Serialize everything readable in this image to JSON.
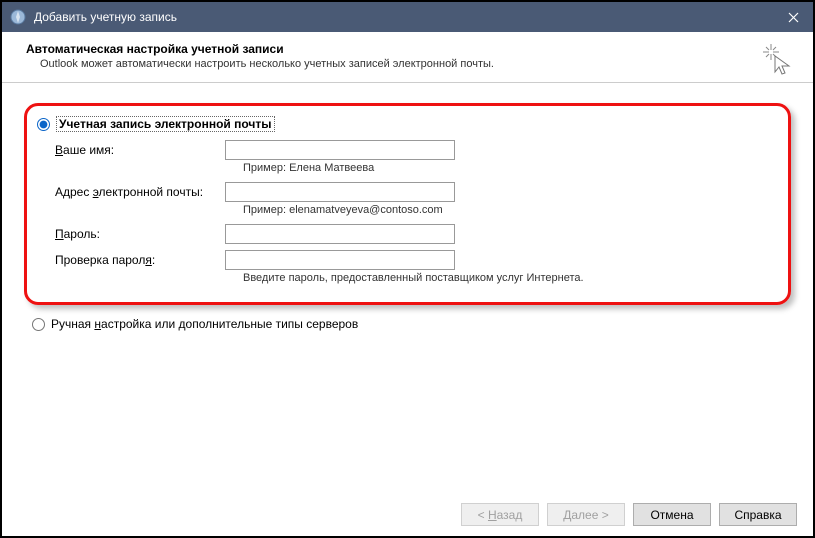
{
  "window": {
    "title": "Добавить учетную запись"
  },
  "header": {
    "title": "Автоматическая настройка учетной записи",
    "subtitle": "Outlook может автоматически настроить несколько учетных записей электронной почты."
  },
  "options": {
    "email_account_label": "Учетная запись электронной почты",
    "manual_label": "Ручная настройка или дополнительные типы серверов"
  },
  "form": {
    "name_label": "Ваше имя:",
    "name_value": "",
    "name_hint": "Пример: Елена Матвеева",
    "email_label": "Адрес электронной почты:",
    "email_value": "",
    "email_hint": "Пример: elenamatveyeva@contoso.com",
    "password_label": "Пароль:",
    "password_value": "",
    "password_confirm_label": "Проверка пароля:",
    "password_confirm_value": "",
    "password_hint": "Введите пароль, предоставленный поставщиком услуг Интернета."
  },
  "buttons": {
    "back": "< Назад",
    "next": "Далее >",
    "cancel": "Отмена",
    "help": "Справка"
  }
}
